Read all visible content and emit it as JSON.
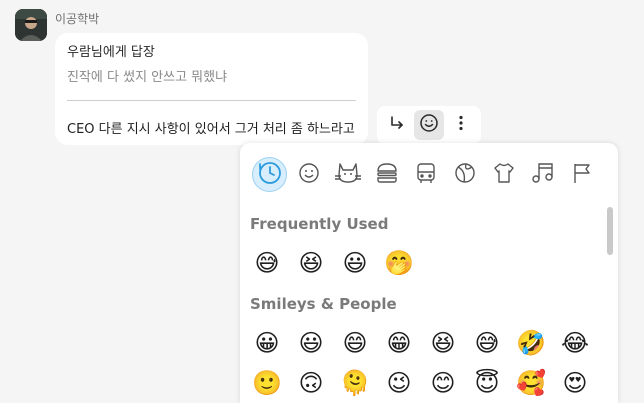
{
  "message": {
    "sender": "이공학박",
    "reply_title": "우람님에게 답장",
    "reply_quote": "진작에 다 썼지 안쓰고 뭐했냐",
    "text": "CEO 다른 지시 사항이 있어서 그거 처리 좀 하느라고"
  },
  "actions": {
    "reply_icon": "reply-arrow-icon",
    "emoji_icon": "smiley-icon",
    "more_icon": "more-vertical-icon"
  },
  "picker": {
    "categories": [
      {
        "name": "recent",
        "icon": "clock-icon",
        "active": true
      },
      {
        "name": "smileys",
        "icon": "smiley-icon"
      },
      {
        "name": "animals",
        "icon": "cat-icon"
      },
      {
        "name": "food",
        "icon": "burger-icon"
      },
      {
        "name": "travel",
        "icon": "bus-icon"
      },
      {
        "name": "activities",
        "icon": "ball-icon"
      },
      {
        "name": "objects",
        "icon": "shirt-icon"
      },
      {
        "name": "symbols",
        "icon": "music-icon"
      },
      {
        "name": "flags",
        "icon": "flag-icon"
      }
    ],
    "frequently_used_title": "Frequently Used",
    "frequently_used": [
      "😅",
      "😆",
      "😃",
      "🤭"
    ],
    "smileys_title": "Smileys & People",
    "smileys_row1": [
      "😀",
      "😃",
      "😄",
      "😁",
      "😆",
      "😅",
      "🤣",
      "😂"
    ],
    "smileys_row2": [
      "🙂",
      "🙃",
      "🫠",
      "😉",
      "😊",
      "😇",
      "🥰",
      "😍"
    ]
  },
  "colors": {
    "accent": "#2b9bdc",
    "accent_bg": "#d8eefd"
  }
}
